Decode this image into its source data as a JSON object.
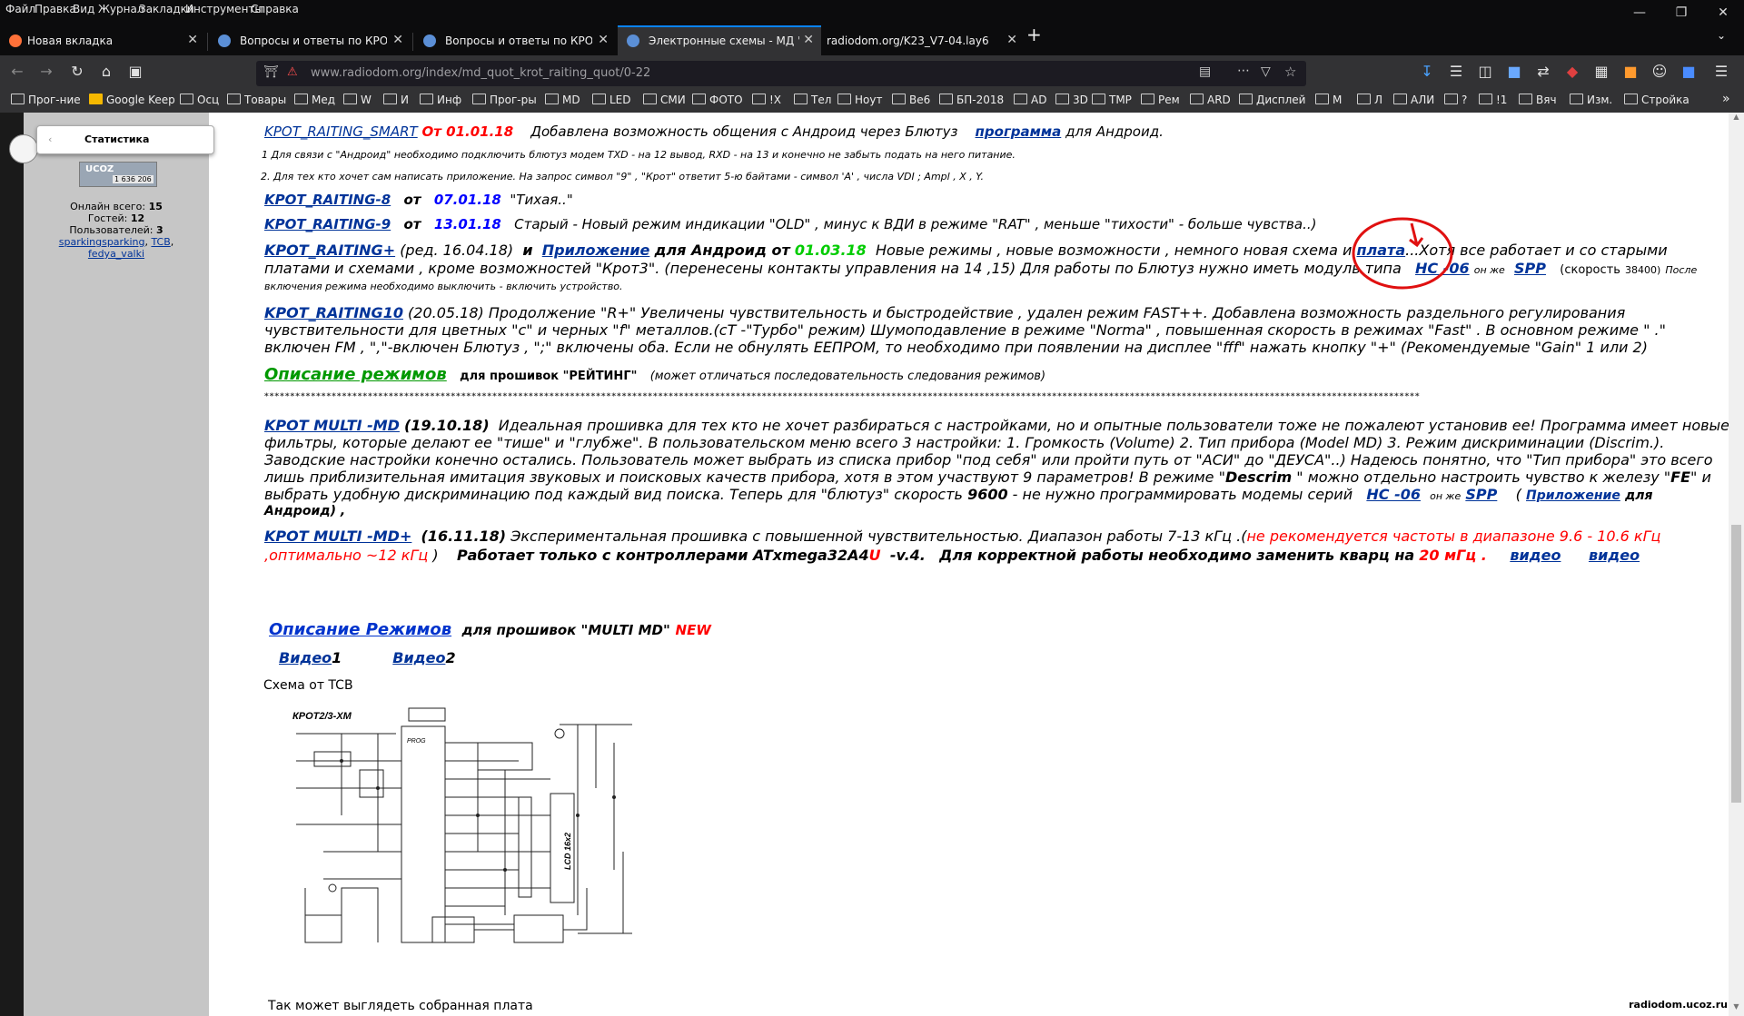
{
  "menu": [
    "Файл",
    "Правка",
    "Вид",
    "Журнал",
    "Закладки",
    "Инструменты",
    "Справка"
  ],
  "tabs": [
    {
      "label": "Новая вкладка",
      "active": false
    },
    {
      "label": "Вопросы и ответы по КРОТу - ",
      "active": false
    },
    {
      "label": "Вопросы и ответы по КРОТу - ",
      "active": false
    },
    {
      "label": "Электронные схемы - МД \"КР",
      "active": true
    },
    {
      "label": "radiodom.org/K23_V7-04.lay6",
      "active": false
    }
  ],
  "url": "www.radiodom.org/index/md_quot_krot_raiting_quot/0-22",
  "bookmarks": [
    "Прог-ние",
    "Google Keep",
    "Осц",
    "Товары",
    "Мед",
    "W",
    "И",
    "Инф",
    "Прог-ры",
    "MD",
    "LED",
    "СМИ",
    "ФОТО",
    "!X",
    "Тел",
    "Ноут",
    "Ве6",
    "БП-2018",
    "AD",
    "3D",
    "TMP",
    "Рем",
    "ARD",
    "Дисплей",
    "М",
    "Л",
    "АЛИ",
    "?",
    "!1",
    "Вяч",
    "Изм.",
    "Стройка"
  ],
  "sidebar": {
    "panel_title": "Статистика",
    "counter_label": "UCOZ",
    "counter_value": "1 636 206",
    "online_total": "Онлайн всего: ",
    "online_total_n": "15",
    "guests": "Гостей: ",
    "guests_n": "12",
    "users": "Пользователей: ",
    "users_n": "3",
    "user1": "sparkingsparking",
    "user2": "TCB",
    "user3": "fedya_valki"
  },
  "content": {
    "l1_link": "KPOT_RAITING_SMART",
    "l1_date": "От 01.01.18",
    "l1_text": "Добавлена возможность общения с Андроид через Блютуз",
    "l1_link2": "программа",
    "l1_text2": "для Андроид.",
    "l2": "1 Для связи с \"Андроид\"  необходимо подключить блютуз модем TXD - на 12 вывод, RXD - на 13 и конечно не забыть подать на него питание.",
    "l3": "2. Для тех кто хочет сам написать приложение.  На запрос символ \"9\" , \"Крот\"  ответит  5-ю байтами - символ  'A' , числа  VDI ; Ampl , X , Y.",
    "l4_link": "KPOT_RAITING-8",
    "l4_ot": "от",
    "l4_date": "07.01.18",
    "l4_text": "\"Тихая..\"",
    "l5_link": "KPOT_RAITING-9",
    "l5_ot": "от",
    "l5_date": "13.01.18",
    "l5_text": "Старый - Новый   режим индикации \"OLD\" , минус к ВДИ в режиме \"RAT\" ,  меньше \"тихости\" - больше чувства..)",
    "l6_link": "KPOT_RAITING+",
    "l6_red": "(ред. 16.04.18)",
    "l6_i": "и",
    "l6_link2": "Приложение",
    "l6_for": "для Андроид от",
    "l6_date": "01.03.18",
    "l6_text": "Новые режимы , новые возможности , немного новая схема и",
    "l6_link3": "плата",
    "l6_text2": "...Хотя все работает и со старыми",
    "l7_text": "платами и схемами , кроме возможностей \"Крот3\". (перенесены контакты управления на 14 ,15) Для работы по Блютуз нужно иметь модуль типа",
    "l7_link": "HC -06",
    "l7_onzhe": "он же",
    "l7_link2": "SPP",
    "l7_speed": "(скорость",
    "l7_speed_n": "38400)",
    "l7_after": "После",
    "l8": "включения режима необходимо выключить - включить устройство.",
    "l9_link": "KPOT_RAITING10",
    "l9_text": "(20.05.18) Продолжение \"R+\"  Увеличены чувствительность и быстродействие , удален режим FAST++.  Добавлена возможность раздельного регулирования",
    "l10": "чувствительности для цветных \"c\" и черных \"f\" металлов.(cT -\"Турбо\" режим)  Шумоподавление в режиме \"Norma\" , повышенная скорость в режимах \"Fast\" .  В основном режиме  \" .\"",
    "l11": " включен FM ,   \",\"-включен Блютуз ,    \";\" включены оба.  Если не обнулять ЕЕПРОМ, то необходимо при появлении на дисплее \"fff\" нажать кнопку \"+\"    (Рекомендуемые  \"Gain\" 1 или 2)",
    "l12_link": "Описание режимов",
    "l12_text": "для прошивок \"РЕЙТИНГ\"",
    "l12_note": "(может отличаться последовательность следования режимов)",
    "stars": "*******************************************************************************************************************************************************************************************************************************",
    "m1_link": "KPOT MULTI -MD",
    "m1_date": "(19.10.18)",
    "m1_text": "Идеальная прошивка для тех кто не хочет разбираться с настройками, но и опытные пользователи тоже не пожалеют установив ее! Программа имеет новые",
    "m2": "фильтры, которые делают ее \"тише\" и \"глубже\". В пользовательском меню всего 3 настройки: 1. Громкость (Volume)  2. Тип прибора (Model MD) 3. Режим дискриминации (Discrim.).",
    "m3": " Заводские настройки конечно остались. Пользователь может  выбрать из списка прибор \"под себя\"  или пройти путь от \"АСИ\" до \"ДЕУСА\"..)  Надеюсь понятно, что \"Тип прибора\" это всего",
    "m4a": "лишь приблизительная имитация звуковых и поисковых качеств прибора,  хотя в этом  участвуют 9 параметров!  В режиме \"",
    "m4b": "Descrim",
    "m4c": " \" можно отдельно настроить чувство к железу \"",
    "m4d": "FE",
    "m4e": "\" и",
    "m5a": "выбрать удобную дискриминацию под каждый вид поиска.  Теперь для \"блютуз\" скорость ",
    "m5b": "9600",
    "m5c": " - не нужно программировать модемы серий",
    "m5_link": "HC -06",
    "m5_onzhe": "он же",
    "m5_link2": "SPP",
    "m5_paren": "(",
    "m5_link3": "Приложение",
    "m5_for": "для",
    "m6": "Андроид) ,",
    "m7_link": "KPOT MULTI -MD+",
    "m7_date": "(16.11.18)",
    "m7_text": "Экспериментальная прошивка с повышенной чувствительностью.  Диапазон работы 7-13 кГц .(",
    "m7_red": "не рекомендуется частоты в диапазоне 9.6 - 10.6 кГц",
    "m8_red": ",оптимально ~12 кГц",
    "m8_paren": ")",
    "m8_text": "Работает только с контроллерами ATxmega32A4",
    "m8_u": "U",
    "m8_v": "-v.4.",
    "m8_text2": "Для корректной работы необходимо заменить кварц на",
    "m8_mhz": "20 мГц .",
    "m8_video1": "видео",
    "m8_video2": "видео",
    "d_link": "Описание Режимов",
    "d_text": "для прошивок \"MULTI MD\"",
    "d_new": "NEW",
    "v1": "Видео",
    "v1n": "1",
    "v2": "Видео",
    "v2n": "2",
    "schema_label": "Схема  от TCB",
    "schema_title": "КРОТ2/3-ХМ",
    "schema_lcd": "LCD 16x2",
    "schema_prog": "PROG",
    "bottom_text": "Так может выглядеть  собранная плата"
  },
  "footer": "radiodom.ucoz.ru"
}
